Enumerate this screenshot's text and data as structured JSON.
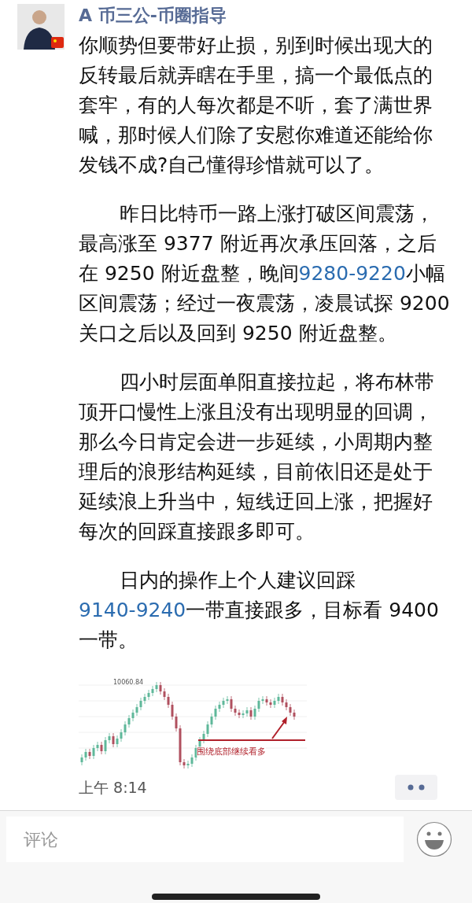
{
  "post": {
    "author": "A 币三公-币圈指导",
    "paragraphs": [
      {
        "indent": false,
        "segments": [
          {
            "kind": "text",
            "text": "你顺势但要带好止损，别到时候出现大的反转最后就弄瞎在手里，搞一个最低点的套牢，有的人每次都是不听，套了满世界喊，那时候人们除了安慰你难道还能给你发钱不成?自己懂得珍惜就可以了。"
          }
        ]
      },
      {
        "indent": true,
        "segments": [
          {
            "kind": "text",
            "text": "昨日比特币一路上涨打破区间震荡，最高涨至 9377 附近再次承压回落，之后在 9250 附近盘整，晚间"
          },
          {
            "kind": "link",
            "text": "9280-9220"
          },
          {
            "kind": "text",
            "text": "小幅区间震荡；经过一夜震荡，凌晨试探 9200 关口之后以及回到 9250 附近盘整。"
          }
        ]
      },
      {
        "indent": true,
        "segments": [
          {
            "kind": "text",
            "text": "四小时层面单阳直接拉起，将布林带顶开口慢性上涨且没有出现明显的回调，那么今日肯定会进一步延续，小周期内整理后的浪形结构延续，目前依旧还是处于延续浪上升当中，短线迂回上涨，把握好每次的回踩直接跟多即可。"
          }
        ]
      },
      {
        "indent": true,
        "segments": [
          {
            "kind": "text",
            "text": "日内的操作上个人建议回踩"
          },
          {
            "kind": "link",
            "text": "9140-9240"
          },
          {
            "kind": "text",
            "text": "一带直接跟多，目标看 9400 一带。"
          }
        ]
      }
    ],
    "image": {
      "peak_label": "10060.84",
      "annotation": "围绕底部继续看多"
    },
    "time": "上午 8:14"
  },
  "comment_bar": {
    "placeholder": "评论"
  }
}
